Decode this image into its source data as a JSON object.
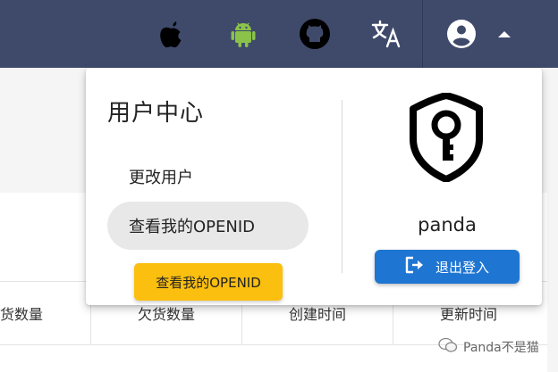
{
  "toolbar": {
    "icons": [
      "apple-icon",
      "android-icon",
      "github-icon",
      "translate-icon",
      "account-icon",
      "caret-up-icon"
    ]
  },
  "table": {
    "headers": [
      "货数量",
      "欠货数量",
      "创建时间",
      "更新时间"
    ]
  },
  "user_menu": {
    "title": "用户中心",
    "items": [
      {
        "label": "更改用户"
      },
      {
        "label": "查看我的OPENID"
      }
    ],
    "username": "panda",
    "logout_label": "退出登入"
  },
  "tooltip": {
    "text": "查看我的OPENID"
  },
  "watermark": {
    "text": "Panda不是猫"
  },
  "colors": {
    "topbar": "#3f4a6b",
    "primary_button": "#1f76d2",
    "tooltip": "#fbbf0f",
    "active_item": "#e8e8e8"
  }
}
